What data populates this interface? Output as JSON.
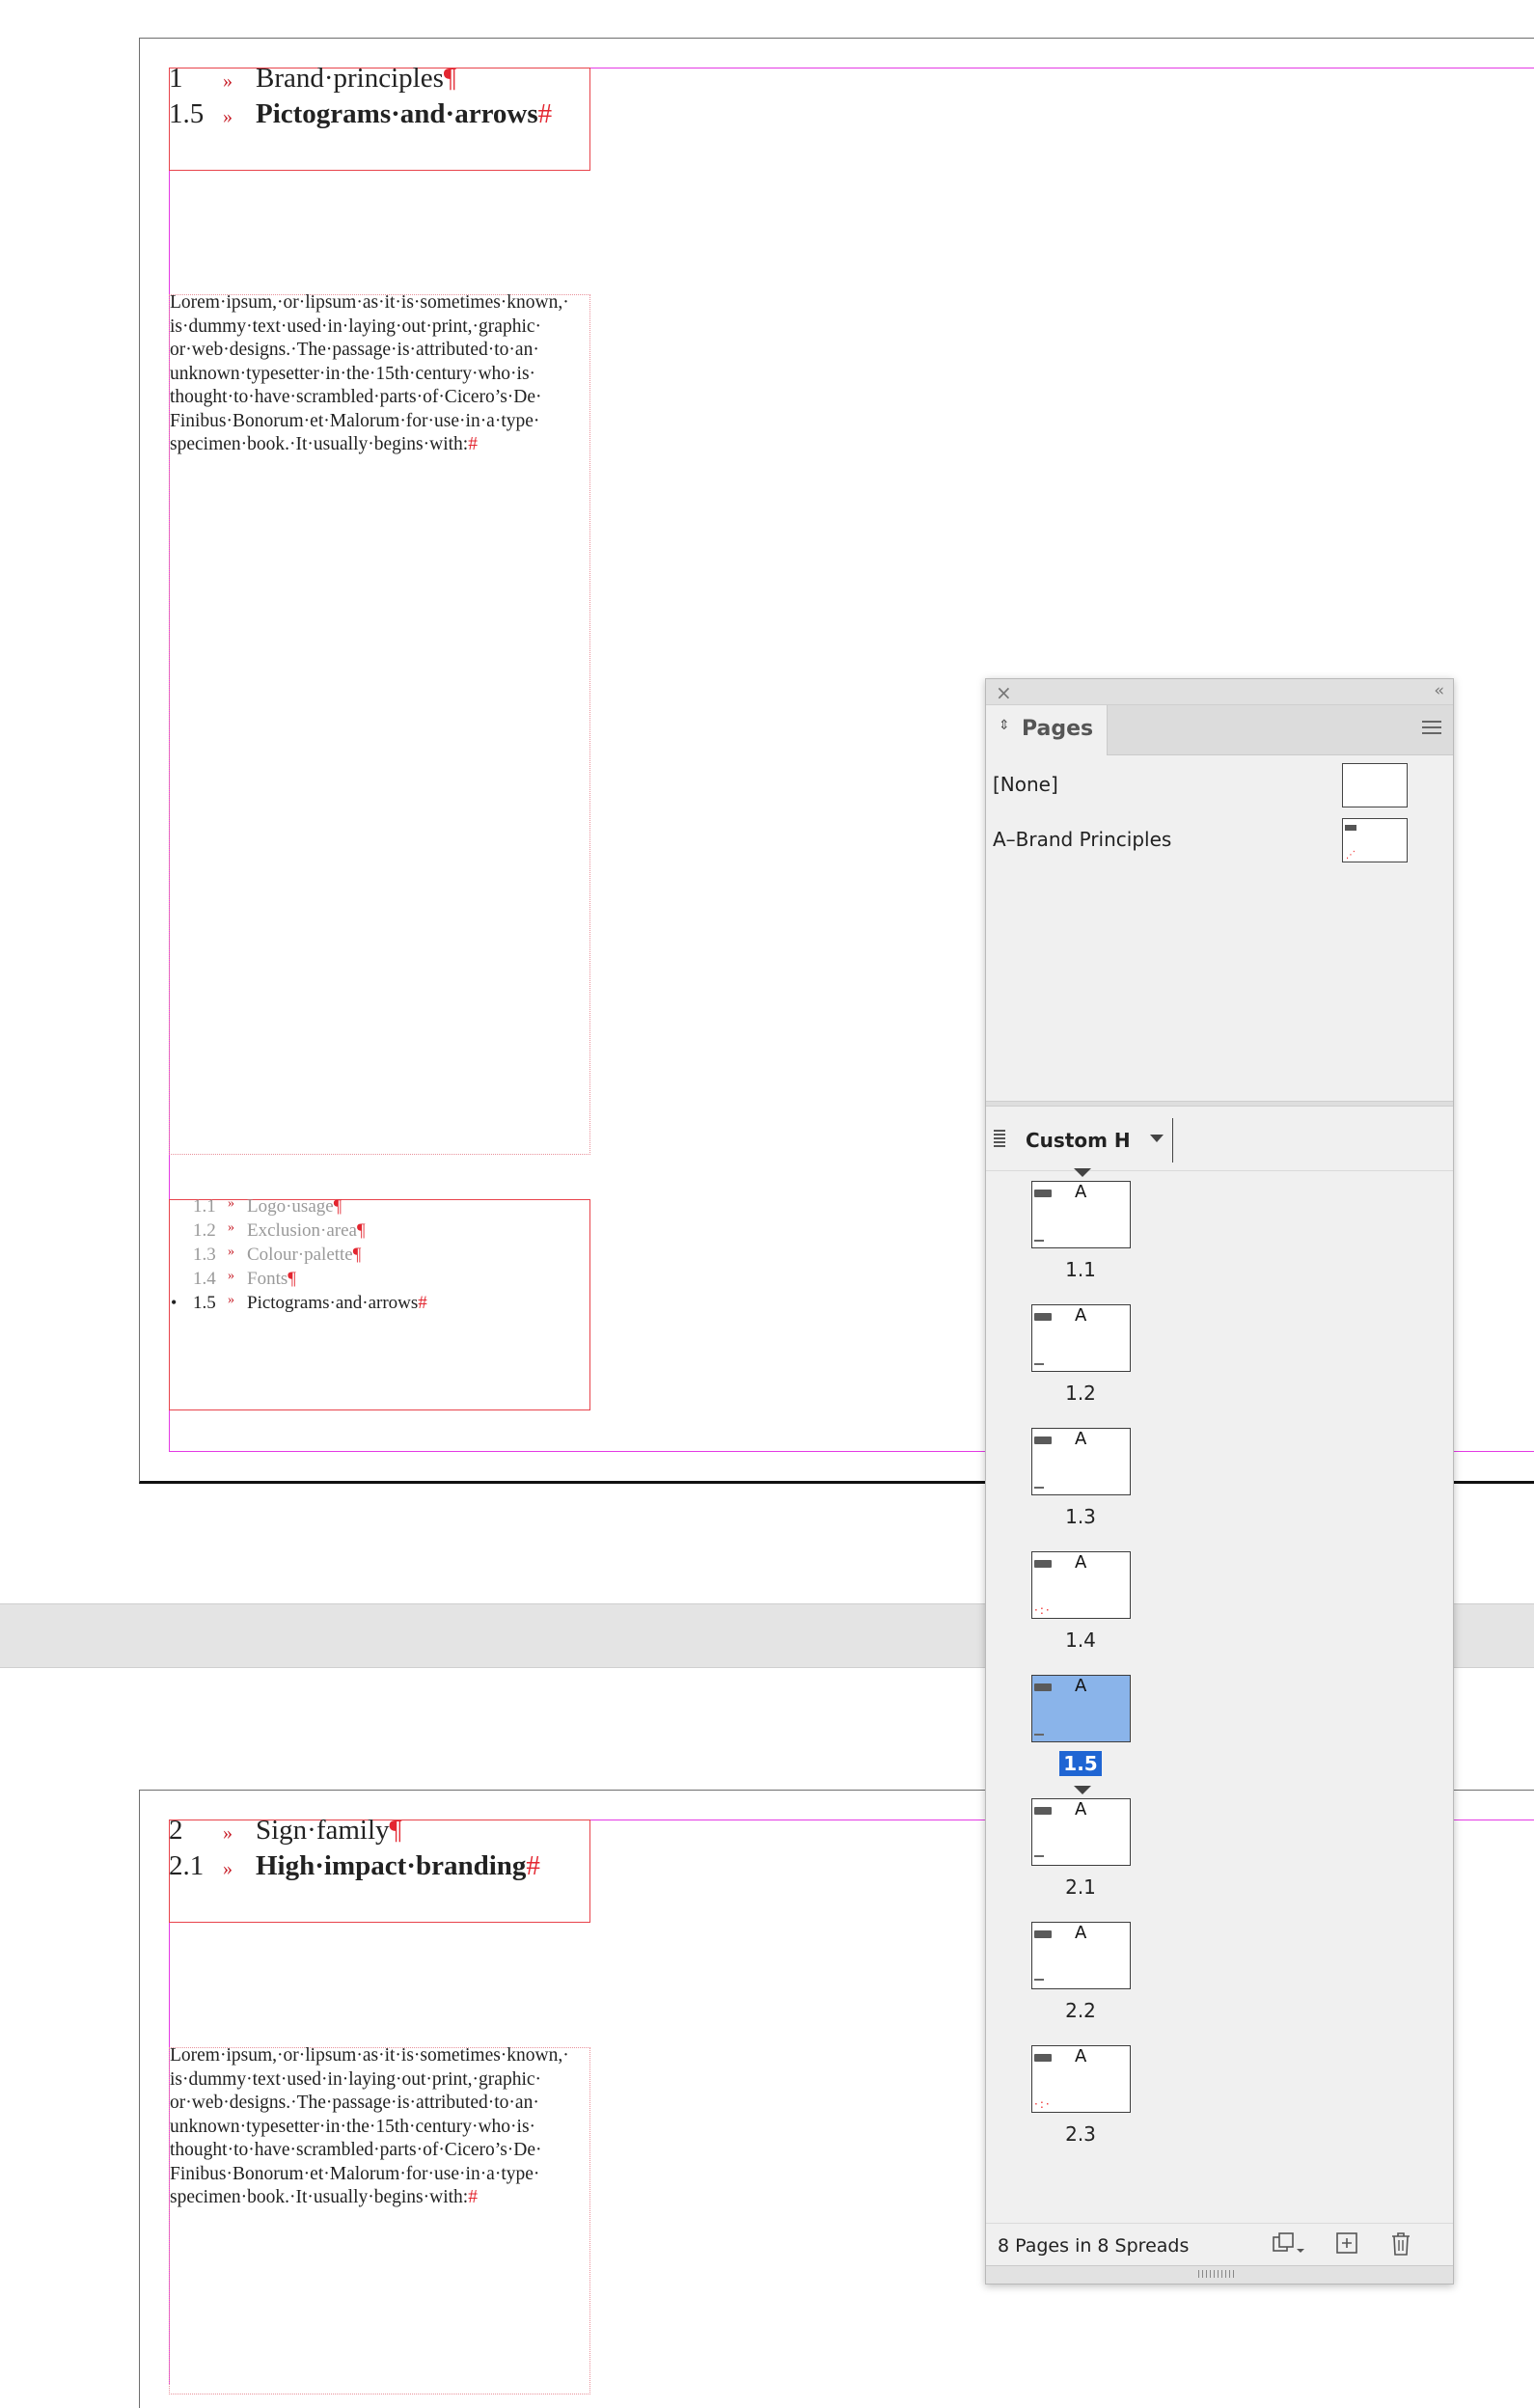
{
  "spread1": {
    "heading1": {
      "num": "1",
      "sep": "»",
      "text": "Brand·principles",
      "end": "¶"
    },
    "heading2": {
      "num": "1.5",
      "sep": "»",
      "text": "Pictograms·and·arrows",
      "end": "#"
    },
    "body_lines": [
      "Lorem·ipsum,·or·lipsum·as·it·is·sometimes·known,·",
      "is·dummy·text·used·in·laying·out·print,·graphic·",
      "or·web·designs.·The·passage·is·attributed·to·an·",
      "unknown·typesetter·in·the·15th·century·who·is·",
      "thought·to·have·scrambled·parts·of·Cicero’s·De·",
      "Finibus·Bonorum·et·Malorum·for·use·in·a·type·",
      "specimen·book.·It·usually·begins·with:"
    ],
    "body_end": "#",
    "toc": [
      {
        "num": "1.1",
        "sep": "»",
        "text": "Logo·usage",
        "end": "¶"
      },
      {
        "num": "1.2",
        "sep": "»",
        "text": "Exclusion·area",
        "end": "¶"
      },
      {
        "num": "1.3",
        "sep": "»",
        "text": "Colour·palette",
        "end": "¶"
      },
      {
        "num": "1.4",
        "sep": "»",
        "text": "Fonts",
        "end": "¶"
      },
      {
        "num": "1.5",
        "sep": "»",
        "text": "Pictograms·and·arrows",
        "end": "#"
      }
    ],
    "bullet": "•"
  },
  "spread2": {
    "heading1": {
      "num": "2",
      "sep": "»",
      "text": "Sign·family",
      "end": "¶"
    },
    "heading2": {
      "num": "2.1",
      "sep": "»",
      "text": "High·impact·branding",
      "end": "#"
    },
    "body_lines": [
      "Lorem·ipsum,·or·lipsum·as·it·is·sometimes·known,·",
      "is·dummy·text·used·in·laying·out·print,·graphic·",
      "or·web·designs.·The·passage·is·attributed·to·an·",
      "unknown·typesetter·in·the·15th·century·who·is·",
      "thought·to·have·scrambled·parts·of·Cicero’s·De·",
      "Finibus·Bonorum·et·Malorum·for·use·in·a·type·",
      "specimen·book.·It·usually·begins·with:"
    ],
    "body_end": "#"
  },
  "panel": {
    "close_glyph": "×",
    "collapse_glyph": "‹‹",
    "tab_arrows": "⇕",
    "title": "Pages",
    "masters": [
      {
        "name": "[None]"
      },
      {
        "name": "A–Brand Principles"
      }
    ],
    "view_label": "Custom H",
    "pages": [
      {
        "label": "1.1",
        "master": "A",
        "selected": false
      },
      {
        "label": "1.2",
        "master": "A",
        "selected": false
      },
      {
        "label": "1.3",
        "master": "A",
        "selected": false
      },
      {
        "label": "1.4",
        "master": "A",
        "selected": false
      },
      {
        "label": "1.5",
        "master": "A",
        "selected": true
      },
      {
        "label": "2.1",
        "master": "A",
        "selected": false
      },
      {
        "label": "2.2",
        "master": "A",
        "selected": false
      },
      {
        "label": "2.3",
        "master": "A",
        "selected": false
      }
    ],
    "status": "8 Pages in 8 Spreads",
    "icons": {
      "edit_page_size": "edit-page-size-icon",
      "new_page": "new-page-icon",
      "delete": "trash-icon"
    },
    "colors": {
      "selection": "#1f65d3",
      "selected_thumb": "#8ab4ea"
    }
  }
}
